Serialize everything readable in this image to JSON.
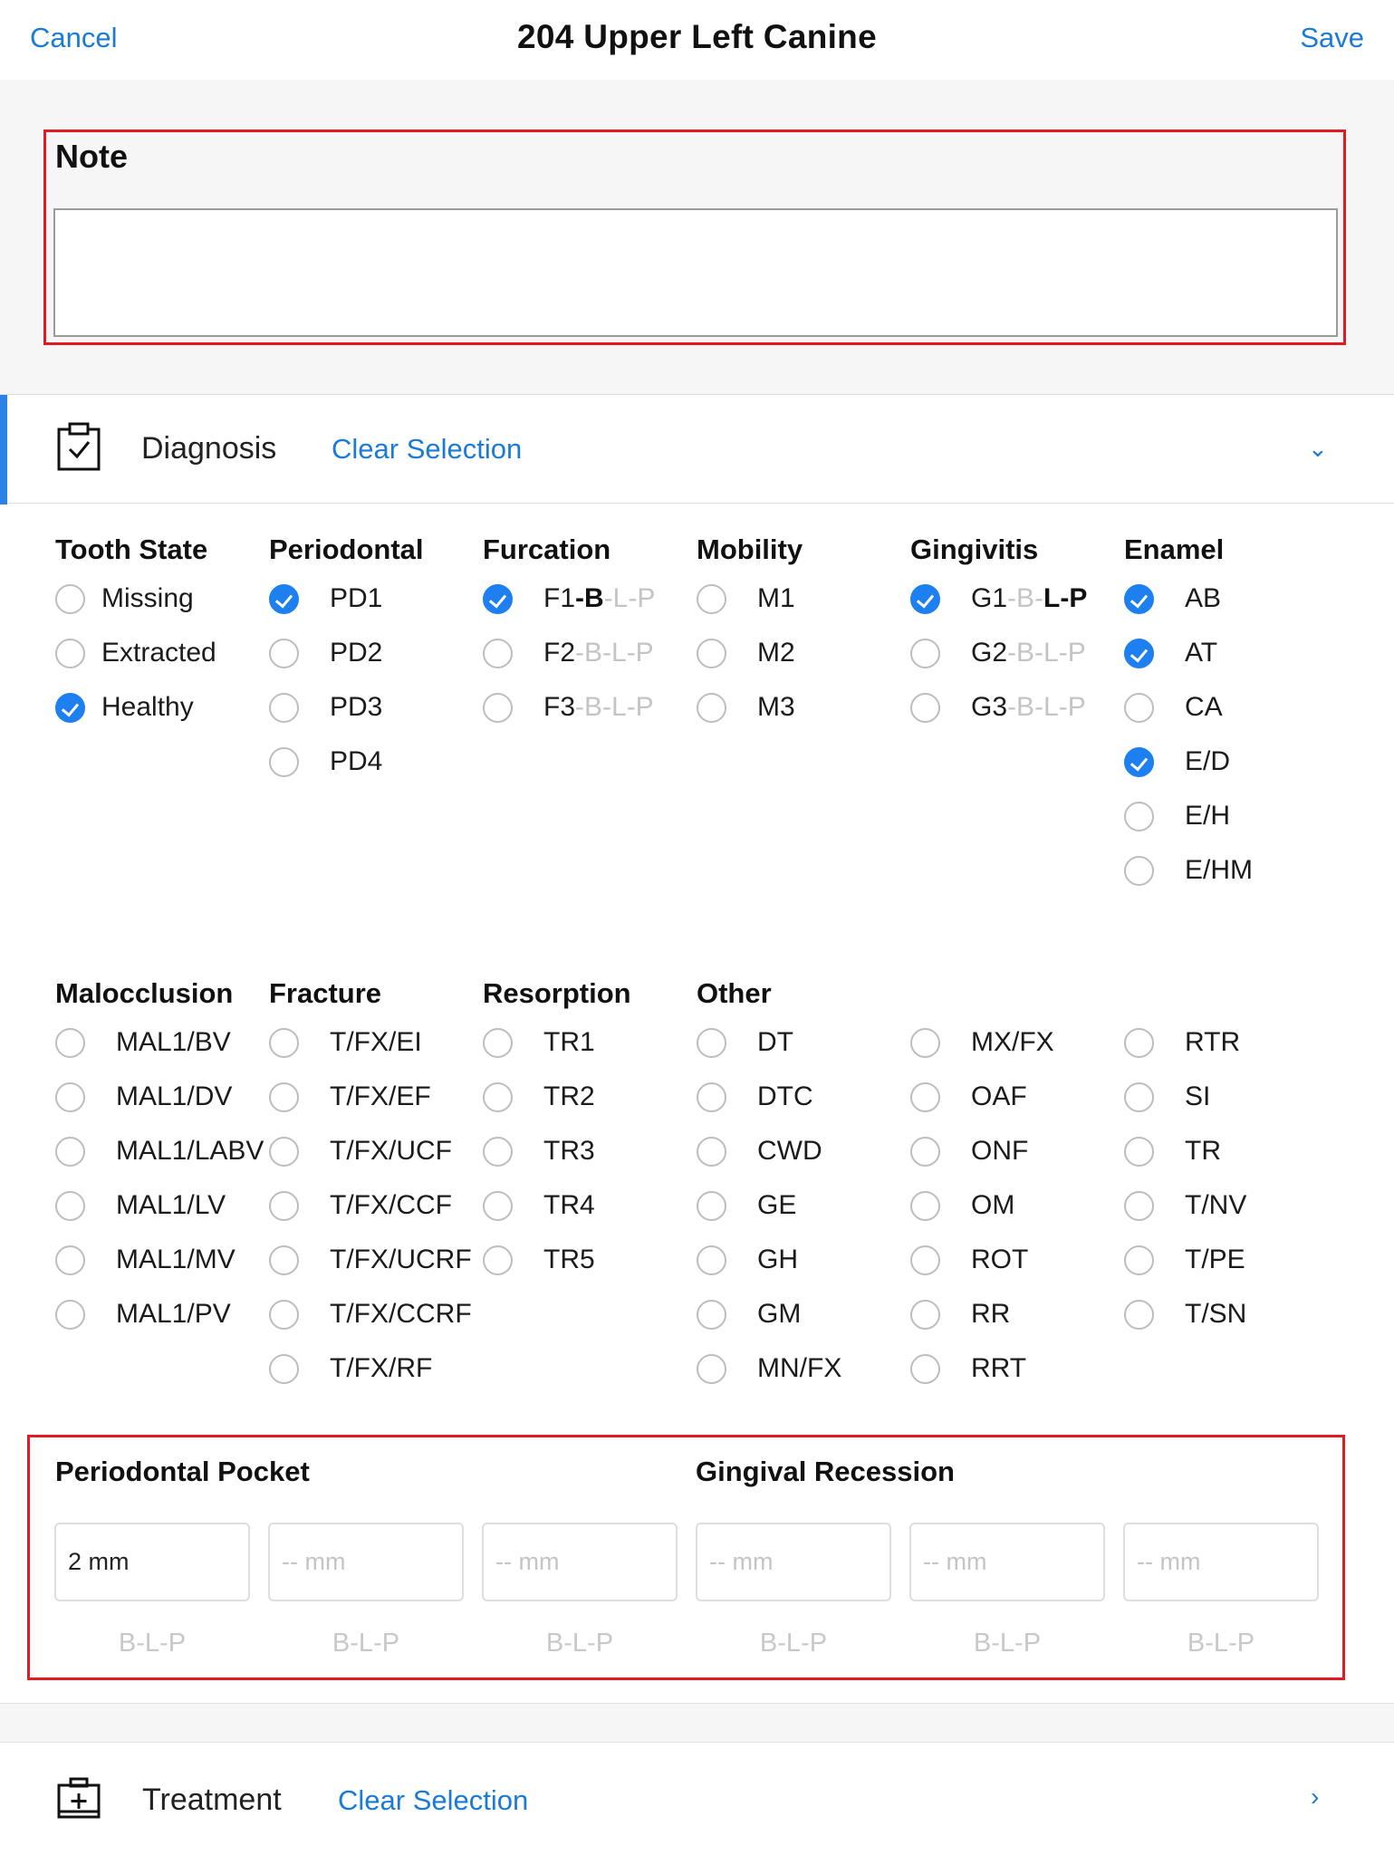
{
  "header": {
    "cancel": "Cancel",
    "title": "204 Upper Left Canine",
    "save": "Save"
  },
  "note": {
    "title": "Note",
    "value": ""
  },
  "diagnosis": {
    "label": "Diagnosis",
    "clear": "Clear Selection",
    "chevron": "⌄",
    "groups": [
      {
        "title": "Tooth State",
        "options": [
          {
            "label": "Missing",
            "checked": false
          },
          {
            "label": "Extracted",
            "checked": false
          },
          {
            "label": "Healthy",
            "checked": true
          }
        ]
      },
      {
        "title": "Periodontal",
        "options": [
          {
            "label": "PD1",
            "checked": true
          },
          {
            "label": "PD2",
            "checked": false
          },
          {
            "label": "PD3",
            "checked": false
          },
          {
            "label": "PD4",
            "checked": false
          }
        ]
      },
      {
        "title": "Furcation",
        "options": [
          {
            "label": "F1",
            "checked": true,
            "segments": [
              {
                "text": "-B",
                "bold": true
              },
              {
                "text": "-L-P",
                "bold": false
              }
            ]
          },
          {
            "label": "F2",
            "checked": false,
            "segments": [
              {
                "text": "-B-L-P",
                "bold": false
              }
            ]
          },
          {
            "label": "F3",
            "checked": false,
            "segments": [
              {
                "text": "-B-L-P",
                "bold": false
              }
            ]
          }
        ]
      },
      {
        "title": "Mobility",
        "options": [
          {
            "label": "M1",
            "checked": false
          },
          {
            "label": "M2",
            "checked": false
          },
          {
            "label": "M3",
            "checked": false
          }
        ]
      },
      {
        "title": "Gingivitis",
        "options": [
          {
            "label": "G1",
            "checked": true,
            "segments": [
              {
                "text": "-B-",
                "bold": false
              },
              {
                "text": "L-P",
                "bold": true
              }
            ]
          },
          {
            "label": "G2",
            "checked": false,
            "segments": [
              {
                "text": "-B-L-P",
                "bold": false
              }
            ]
          },
          {
            "label": "G3",
            "checked": false,
            "segments": [
              {
                "text": "-B-L-P",
                "bold": false
              }
            ]
          }
        ]
      },
      {
        "title": "Enamel",
        "options": [
          {
            "label": "AB",
            "checked": true
          },
          {
            "label": "AT",
            "checked": true
          },
          {
            "label": "CA",
            "checked": false
          },
          {
            "label": "E/D",
            "checked": true
          },
          {
            "label": "E/H",
            "checked": false
          },
          {
            "label": "E/HM",
            "checked": false
          }
        ]
      },
      {
        "title": "Malocclusion",
        "options": [
          {
            "label": "MAL1/BV",
            "checked": false
          },
          {
            "label": "MAL1/DV",
            "checked": false
          },
          {
            "label": "MAL1/LABV",
            "checked": false
          },
          {
            "label": "MAL1/LV",
            "checked": false
          },
          {
            "label": "MAL1/MV",
            "checked": false
          },
          {
            "label": "MAL1/PV",
            "checked": false
          }
        ]
      },
      {
        "title": "Fracture",
        "options": [
          {
            "label": "T/FX/EI",
            "checked": false
          },
          {
            "label": "T/FX/EF",
            "checked": false
          },
          {
            "label": "T/FX/UCF",
            "checked": false
          },
          {
            "label": "T/FX/CCF",
            "checked": false
          },
          {
            "label": "T/FX/UCRF",
            "checked": false
          },
          {
            "label": "T/FX/CCRF",
            "checked": false
          },
          {
            "label": "T/FX/RF",
            "checked": false
          }
        ]
      },
      {
        "title": "Resorption",
        "options": [
          {
            "label": "TR1",
            "checked": false
          },
          {
            "label": "TR2",
            "checked": false
          },
          {
            "label": "TR3",
            "checked": false
          },
          {
            "label": "TR4",
            "checked": false
          },
          {
            "label": "TR5",
            "checked": false
          }
        ]
      },
      {
        "title": "Other",
        "options": [
          {
            "label": "DT",
            "checked": false
          },
          {
            "label": "DTC",
            "checked": false
          },
          {
            "label": "CWD",
            "checked": false
          },
          {
            "label": "GE",
            "checked": false
          },
          {
            "label": "GH",
            "checked": false
          },
          {
            "label": "GM",
            "checked": false
          },
          {
            "label": "MN/FX",
            "checked": false
          }
        ]
      },
      {
        "title": "",
        "options": [
          {
            "label": "MX/FX",
            "checked": false
          },
          {
            "label": "OAF",
            "checked": false
          },
          {
            "label": "ONF",
            "checked": false
          },
          {
            "label": "OM",
            "checked": false
          },
          {
            "label": "ROT",
            "checked": false
          },
          {
            "label": "RR",
            "checked": false
          },
          {
            "label": "RRT",
            "checked": false
          }
        ]
      },
      {
        "title": "",
        "options": [
          {
            "label": "RTR",
            "checked": false
          },
          {
            "label": "SI",
            "checked": false
          },
          {
            "label": "TR",
            "checked": false
          },
          {
            "label": "T/NV",
            "checked": false
          },
          {
            "label": "T/PE",
            "checked": false
          },
          {
            "label": "T/SN",
            "checked": false
          }
        ]
      }
    ]
  },
  "measurements": {
    "periodontal_pocket_title": "Periodontal Pocket",
    "gingival_recession_title": "Gingival Recession",
    "fields": [
      {
        "value": "2 mm",
        "placeholder": "-- mm",
        "caption": "B-L-P"
      },
      {
        "value": "",
        "placeholder": "-- mm",
        "caption": "B-L-P"
      },
      {
        "value": "",
        "placeholder": "-- mm",
        "caption": "B-L-P"
      },
      {
        "value": "",
        "placeholder": "-- mm",
        "caption": "B-L-P"
      },
      {
        "value": "",
        "placeholder": "-- mm",
        "caption": "B-L-P"
      },
      {
        "value": "",
        "placeholder": "-- mm",
        "caption": "B-L-P"
      }
    ]
  },
  "treatment": {
    "label": "Treatment",
    "clear": "Clear Selection",
    "chevron": "›"
  },
  "colors": {
    "accent": "#1e7ff0",
    "link": "#1a7bd6",
    "highlight": "#e21a22",
    "section_bg": "#f6f6f6"
  },
  "icons": {
    "diagnosis": "clipboard-check-icon",
    "treatment": "medical-kit-icon",
    "checkbox": "checkmark-icon"
  }
}
